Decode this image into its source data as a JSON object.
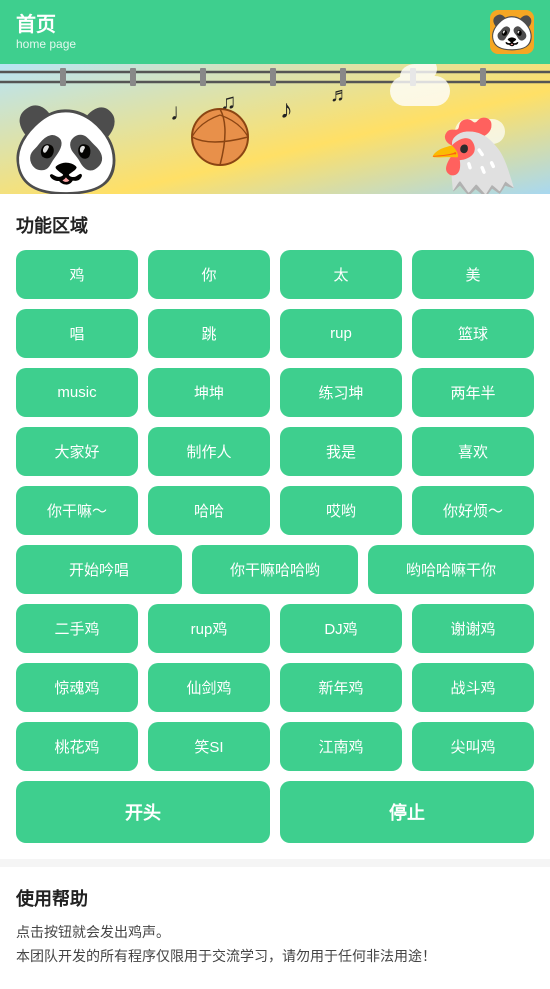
{
  "header": {
    "title": "首页",
    "subtitle": "home page",
    "avatar_label": "panda"
  },
  "banner": {
    "music_notes": [
      "♩",
      "♫",
      "♪",
      "♬"
    ],
    "bg_color": "#ffe066"
  },
  "function_section": {
    "title": "功能区域",
    "rows": [
      [
        "鸡",
        "你",
        "太",
        "美"
      ],
      [
        "唱",
        "跳",
        "rup",
        "篮球"
      ],
      [
        "music",
        "坤坤",
        "练习坤",
        "两年半"
      ],
      [
        "大家好",
        "制作人",
        "我是",
        "喜欢"
      ],
      [
        "你干嘛～",
        "哈哈",
        "哎哟",
        "你好烦～"
      ]
    ],
    "wide_row": [
      "开始吟唱",
      "你干嘛哈哈哟",
      "哟哈哈嘛干你"
    ],
    "rows2": [
      [
        "二手鸡",
        "rup鸡",
        "DJ鸡",
        "谢谢鸡"
      ],
      [
        "惊魂鸡",
        "仙剑鸡",
        "新年鸡",
        "战斗鸡"
      ],
      [
        "桃花鸡",
        "笑SI",
        "江南鸡",
        "尖叫鸡"
      ]
    ],
    "action_start": "开头",
    "action_stop": "停止"
  },
  "help_section": {
    "title": "使用帮助",
    "lines": [
      "点击按钮就会发出鸡声。",
      "本团队开发的所有程序仅限用于交流学习，请勿用于任何非法用途！"
    ]
  }
}
